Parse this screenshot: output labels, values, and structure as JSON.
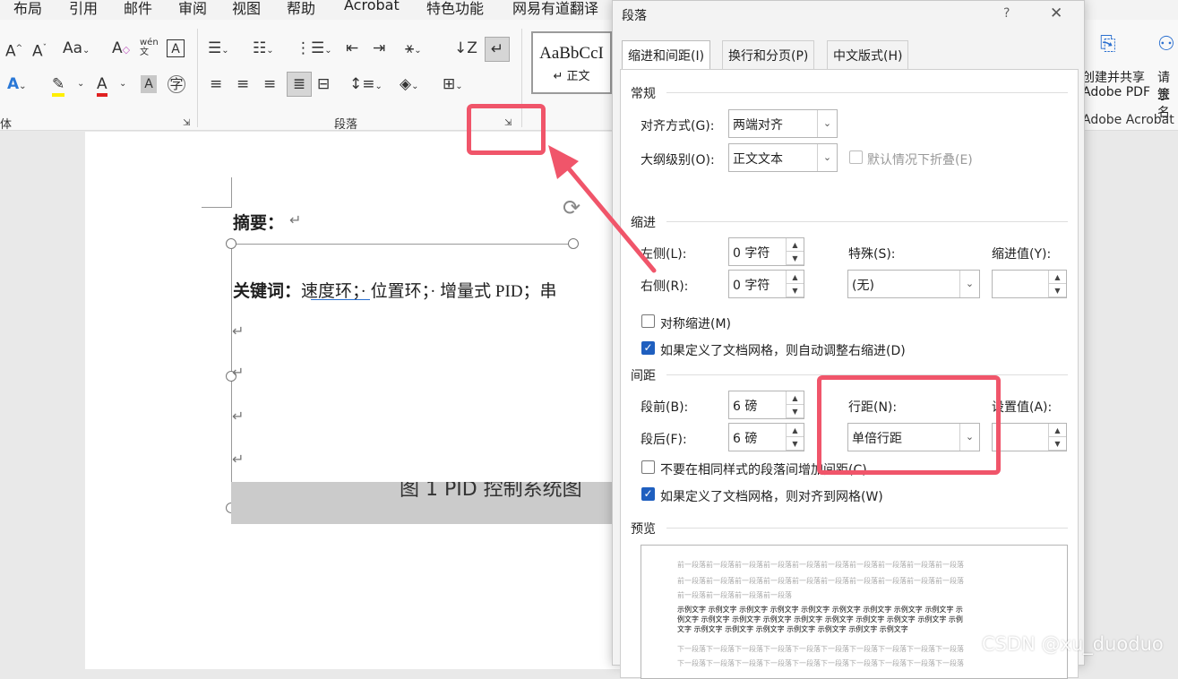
{
  "menubar": {
    "items": [
      "布局",
      "引用",
      "邮件",
      "审阅",
      "视图",
      "帮助",
      "Acrobat",
      "特色功能",
      "网易有道翻译"
    ]
  },
  "ribbon": {
    "font_group_label": "体",
    "paragraph_group_label": "段落",
    "style_sample": "AaBbCcI",
    "style_name": "↵ 正文",
    "acrobat": {
      "create_share_line1": "创建并共享",
      "create_share_line2": "Adobe PDF",
      "request_sign_line1": "请求",
      "request_sign_line2": "签名",
      "group_label": "Adobe Acrobat"
    }
  },
  "document": {
    "abstract_label": "摘要：",
    "keywords_label": "关键词：",
    "keywords_text": "速度环；· 位置环；· 增量式 PID；串",
    "keyword_underlined": "速度环",
    "return_mark": "↵",
    "figure_caption": "图 1   PID 控制系统图"
  },
  "dialog": {
    "title": "段落",
    "help": "?",
    "close": "✕",
    "tabs": [
      "缩进和间距(I)",
      "换行和分页(P)",
      "中文版式(H)"
    ],
    "general": {
      "heading": "常规",
      "alignment_label": "对齐方式(G):",
      "alignment_value": "两端对齐",
      "outline_label": "大纲级别(O):",
      "outline_value": "正文文本",
      "collapse_label": "默认情况下折叠(E)"
    },
    "indent": {
      "heading": "缩进",
      "left_label": "左侧(L):",
      "left_value": "0 字符",
      "right_label": "右侧(R):",
      "right_value": "0 字符",
      "special_label": "特殊(S):",
      "special_value": "(无)",
      "by_label": "缩进值(Y):",
      "by_value": "",
      "mirror_label": "对称缩进(M)",
      "auto_adjust_label": "如果定义了文档网格，则自动调整右缩进(D)"
    },
    "spacing": {
      "heading": "间距",
      "before_label": "段前(B):",
      "before_value": "6 磅",
      "after_label": "段后(F):",
      "after_value": "6 磅",
      "line_label": "行距(N):",
      "line_value": "单倍行距",
      "at_label": "设置值(A):",
      "at_value": "",
      "no_space_label": "不要在相同样式的段落间增加间距(C)",
      "snap_grid_label": "如果定义了文档网格，则对齐到网格(W)"
    },
    "preview": {
      "heading": "预览",
      "prev_lines": [
        "前一段落前一段落前一段落前一段落前一段落前一段落前一段落前一段落前一段落前一段落",
        "前一段落前一段落前一段落前一段落前一段落前一段落前一段落前一段落前一段落前一段落",
        "前一段落前一段落前一段落前一段落"
      ],
      "sample_lines": [
        "示例文字 示例文字 示例文字 示例文字 示例文字 示例文字 示例文字 示例文字 示例文字 示",
        "例文字 示例文字 示例文字 示例文字 示例文字 示例文字 示例文字 示例文字 示例文字 示例",
        "文字 示例文字 示例文字 示例文字 示例文字 示例文字 示例文字 示例文字"
      ],
      "next_lines": [
        "下一段落下一段落下一段落下一段落下一段落下一段落下一段落下一段落下一段落下一段落",
        "下一段落下一段落下一段落下一段落下一段落下一段落下一段落下一段落下一段落下一段落"
      ]
    }
  },
  "watermark": "CSDN @xu_duoduo",
  "colors": {
    "annotation_red": "#f0556a",
    "checkbox_blue": "#1f5fbf"
  }
}
